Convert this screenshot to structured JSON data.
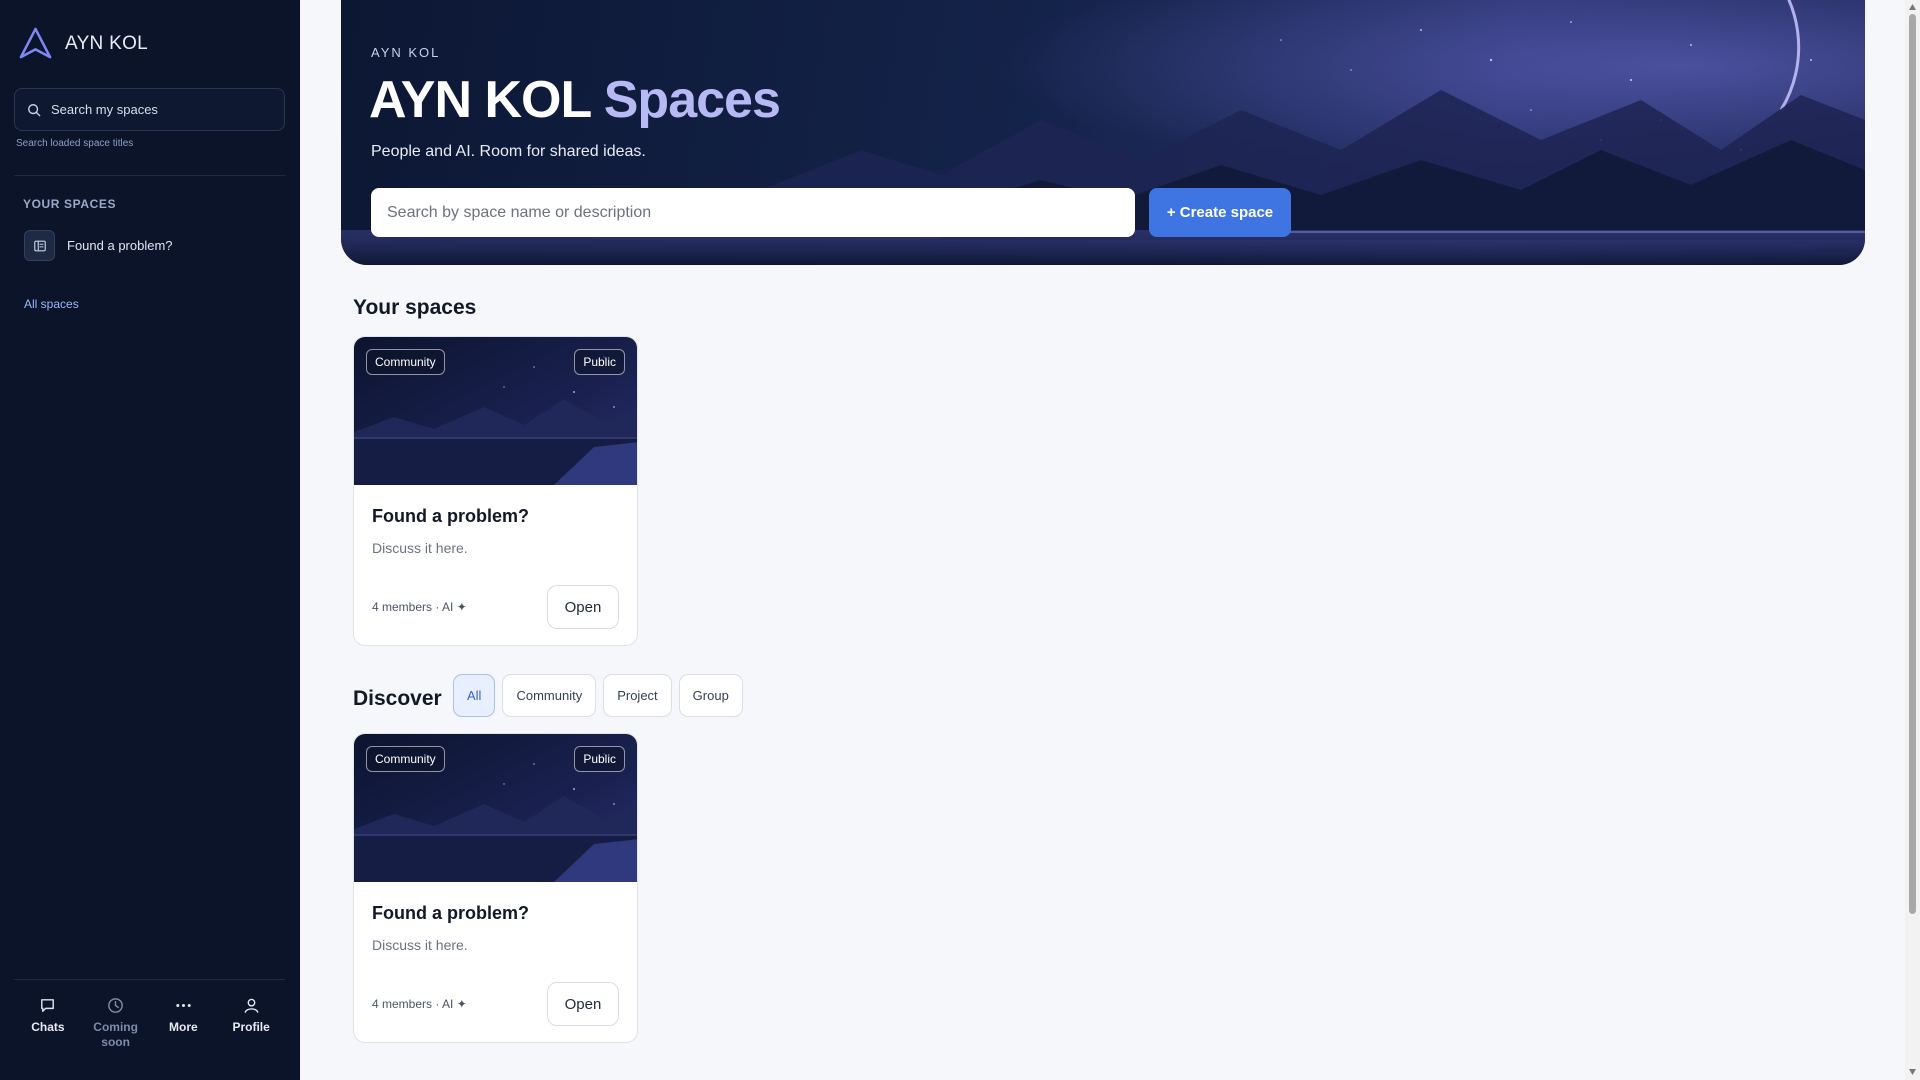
{
  "sidebar": {
    "brand": "AYN KOL",
    "search_label": "Search my spaces",
    "search_hint": "Search loaded space titles",
    "section_title": "YOUR SPACES",
    "spaces": [
      {
        "label": "Found a problem?"
      }
    ],
    "all_spaces_link": "All spaces",
    "bottom_nav": [
      {
        "label": "Chats",
        "icon": "chat-icon"
      },
      {
        "label": "Coming soon",
        "icon": "clock-icon"
      },
      {
        "label": "More",
        "icon": "more-icon"
      },
      {
        "label": "Profile",
        "icon": "user-icon"
      }
    ]
  },
  "hero": {
    "eyebrow": "AYN KOL",
    "title_main": "AYN KOL",
    "title_accent": "Spaces",
    "subtitle": "People and AI. Room for shared ideas.",
    "search_placeholder": "Search by space name or description",
    "create_button": "+ Create space"
  },
  "your_spaces": {
    "title": "Your spaces",
    "cards": [
      {
        "tag_type": "Community",
        "tag_visibility": "Public",
        "title": "Found a problem?",
        "description": "Discuss it here.",
        "meta": "4 members · AI ✦",
        "open_label": "Open"
      }
    ]
  },
  "discover": {
    "title": "Discover",
    "filters": [
      "All",
      "Community",
      "Project",
      "Group"
    ],
    "active_filter": "All",
    "cards": [
      {
        "tag_type": "Community",
        "tag_visibility": "Public",
        "title": "Found a problem?",
        "description": "Discuss it here.",
        "meta": "4 members · AI ✦",
        "open_label": "Open"
      }
    ]
  },
  "colors": {
    "sidebar_bg": "#0b1428",
    "accent": "#3f74e3",
    "title_accent": "#b7b9f5"
  }
}
